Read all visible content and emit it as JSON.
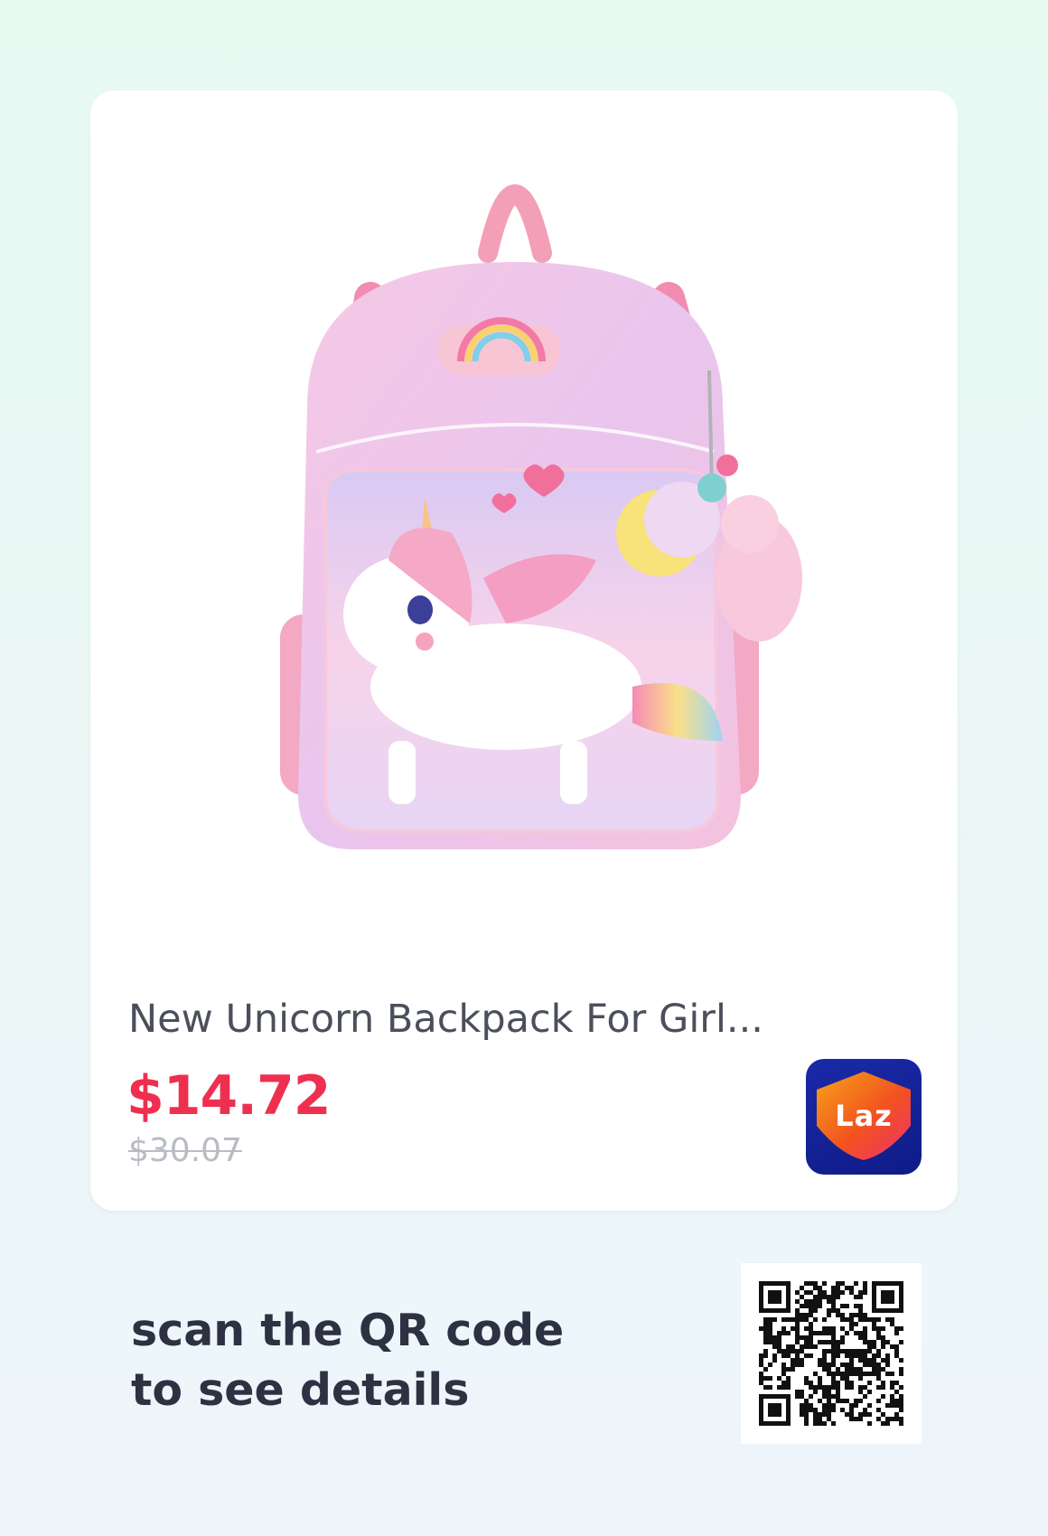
{
  "product": {
    "title": "New Unicorn Backpack For Girl...",
    "price_current": "$14.72",
    "price_original": "$30.07",
    "image_icon": "unicorn-backpack-product-image"
  },
  "store": {
    "logo_text": "Laz",
    "logo_icon": "lazada-heart-icon",
    "colors": {
      "background": "#1a2aa8",
      "heart_top": "#f7a21c",
      "heart_bottom": "#ef2f6f"
    }
  },
  "footer": {
    "line1": "scan the QR code",
    "line2": "to see details",
    "qr_icon": "qr-code-icon"
  },
  "colors": {
    "price": "#ef2f4f",
    "title": "#4b4f5c",
    "strikethrough": "#b9bcc3",
    "footer_text": "#2c3242"
  }
}
